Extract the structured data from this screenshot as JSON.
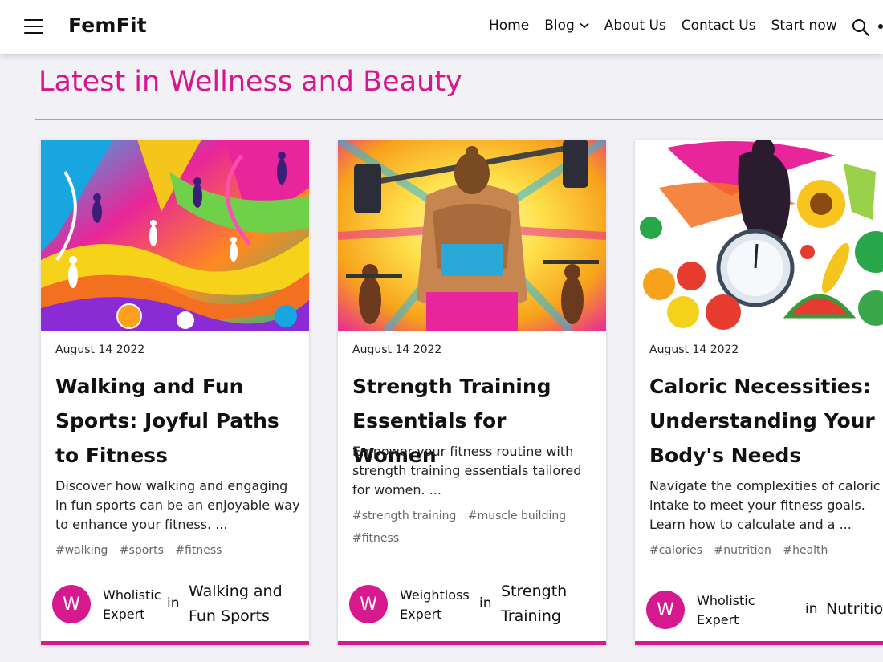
{
  "header": {
    "logo": "FemFit",
    "nav": [
      {
        "label": "Home"
      },
      {
        "label": "Blog"
      },
      {
        "label": "About Us"
      },
      {
        "label": "Contact Us"
      },
      {
        "label": "Start now"
      }
    ]
  },
  "section": {
    "title": "Latest in Wellness and Beauty"
  },
  "cards": [
    {
      "date": "August 14 2022",
      "title": "Walking and Fun Sports: Joyful Paths to Fitness",
      "excerpt": "Discover how walking and engaging in fun sports can be an enjoyable way to enhance your fitness. ...",
      "tags": [
        "#walking",
        "#sports",
        "#fitness"
      ],
      "avatar_letter": "W",
      "author": "Wholistic Expert",
      "in": "in",
      "category": "Walking and Fun Sports"
    },
    {
      "date": "August 14 2022",
      "title": "Strength Training Essentials for Women",
      "excerpt": "Empower your fitness routine with strength training essentials tailored for women. ...",
      "tags": [
        "#strength training",
        "#muscle building",
        "#fitness"
      ],
      "avatar_letter": "W",
      "author": "Weightloss Expert",
      "in": "in",
      "category": "Strength Training"
    },
    {
      "date": "August 14 2022",
      "title": "Caloric Necessities: Understanding Your Body's Needs",
      "excerpt": "Navigate the complexities of caloric intake to meet your fitness goals. Learn how to calculate and a ...",
      "tags": [
        "#calories",
        "#nutrition",
        "#health"
      ],
      "avatar_letter": "W",
      "author": "Wholistic Expert",
      "in": "in",
      "category": "Nutrition"
    }
  ],
  "colors": {
    "accent": "#d6168f",
    "divider": "#e77ec2",
    "background": "#f1f1f6"
  },
  "icons": [
    "menu-icon",
    "chevron-down-icon",
    "search-icon"
  ]
}
